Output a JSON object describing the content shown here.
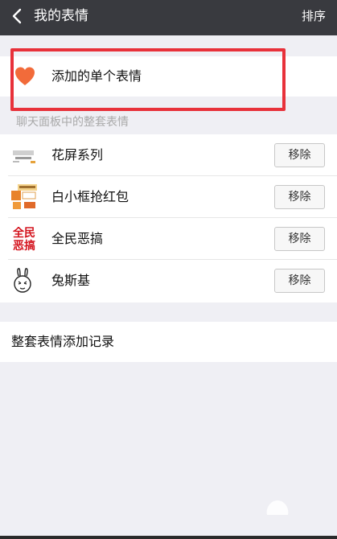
{
  "header": {
    "title": "我的表情",
    "sort_label": "排序",
    "back_icon": "chevron-left-icon"
  },
  "single": {
    "label": "添加的单个表情",
    "icon": "heart-icon",
    "icon_color": "#f26b3a"
  },
  "sets_section": {
    "label": "聊天面板中的整套表情",
    "items": [
      {
        "name": "花屏系列",
        "button": "移除"
      },
      {
        "name": "白小框抢红包",
        "button": "移除"
      },
      {
        "name": "全民恶搞",
        "button": "移除",
        "thumb_text_1": "全民",
        "thumb_text_2": "恶搞"
      },
      {
        "name": "兔斯基",
        "button": "移除"
      }
    ]
  },
  "record": {
    "label": "整套表情添加记录"
  },
  "colors": {
    "topbar": "#393a3f",
    "highlight_border": "#e8313a",
    "background": "#efeff4"
  }
}
